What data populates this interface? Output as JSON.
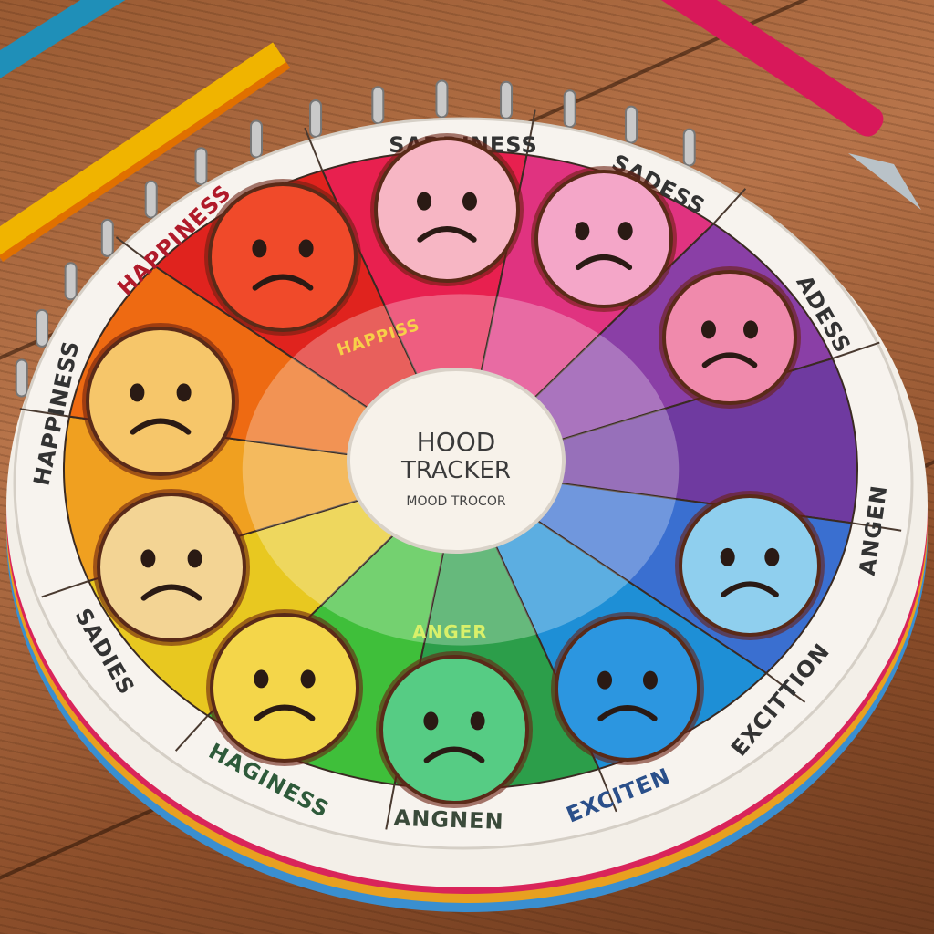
{
  "center": {
    "title_line1": "HOOD",
    "title_line2": "TRACKER",
    "subtitle": "MOOD TROCOR"
  },
  "rim_labels": [
    "SADDINESS",
    "SADESS",
    "ADESS",
    "ANGEN",
    "EXCITTION",
    "EXCITEN",
    "ANGNEN",
    "HAGINESS",
    "SADIES",
    "HAPPINESS",
    "HAPPINESS"
  ],
  "inner_labels": [
    "HAPPISS",
    "ANGER"
  ],
  "segment_colors": [
    "#e0231e",
    "#e8204f",
    "#e03380",
    "#8a3fa6",
    "#6f3aa0",
    "#3a6fd0",
    "#1e8fd6",
    "#2c9e4a",
    "#3fbf3a",
    "#e8c820",
    "#f0a020",
    "#ee6a12"
  ]
}
